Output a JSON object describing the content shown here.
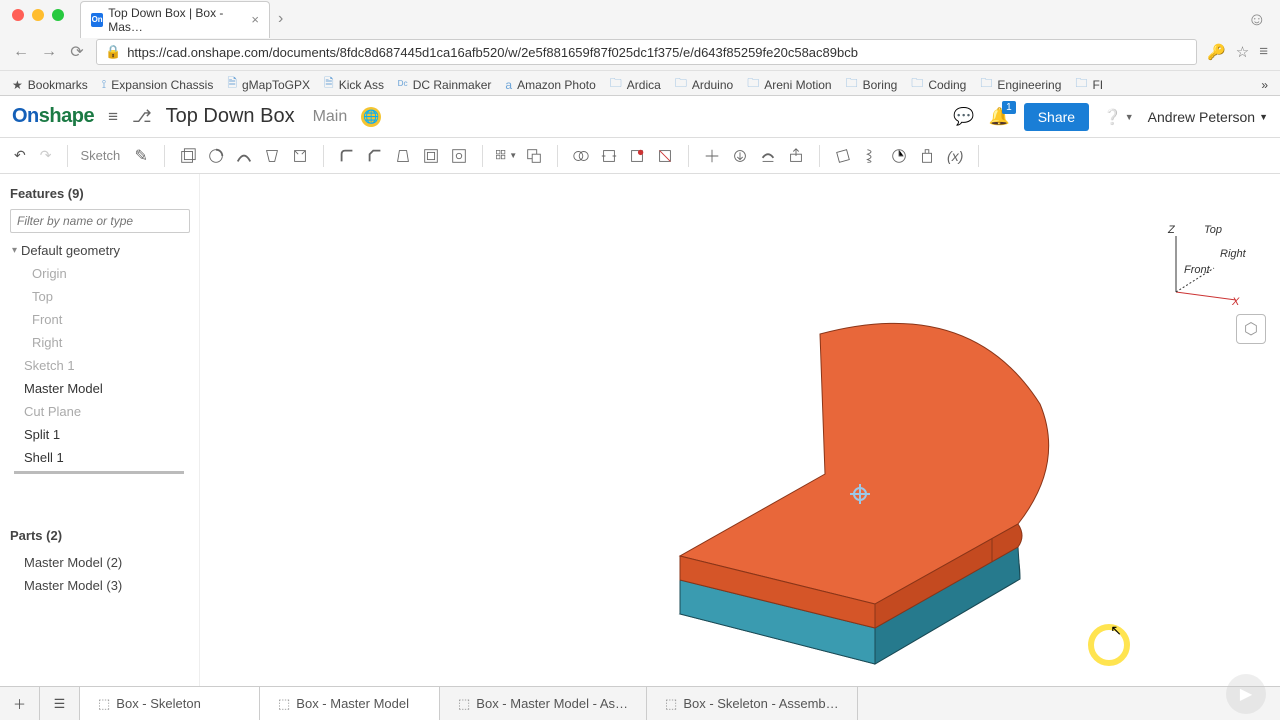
{
  "browser": {
    "tab_title": "Top Down Box | Box - Mas…",
    "favicon": "On",
    "url": "https://cad.onshape.com/documents/8fdc8d687445d1ca16afb520/w/2e5f881659f87f025dc1f375/e/d643f85259fe20c58ac89bcb",
    "bookmarks_label": "Bookmarks",
    "bookmarks": [
      "Expansion Chassis",
      "gMapToGPX",
      "Kick Ass",
      "DC Rainmaker",
      "Amazon Photo",
      "Ardica",
      "Arduino",
      "Areni Motion",
      "Boring",
      "Coding",
      "Engineering",
      "FI"
    ]
  },
  "app": {
    "logo": "Onshape",
    "doc_title": "Top Down Box",
    "branch": "Main",
    "share": "Share",
    "notif_count": "1",
    "user": "Andrew Peterson"
  },
  "toolbar": {
    "sketch": "Sketch"
  },
  "features": {
    "title": "Features (9)",
    "filter_placeholder": "Filter by name or type",
    "group": "Default geometry",
    "items": [
      {
        "label": "Origin",
        "active": false
      },
      {
        "label": "Top",
        "active": false
      },
      {
        "label": "Front",
        "active": false
      },
      {
        "label": "Right",
        "active": false
      },
      {
        "label": "Sketch 1",
        "active": false
      },
      {
        "label": "Master Model",
        "active": true
      },
      {
        "label": "Cut Plane",
        "active": false
      },
      {
        "label": "Split 1",
        "active": true
      },
      {
        "label": "Shell 1",
        "active": true
      }
    ]
  },
  "parts": {
    "title": "Parts (2)",
    "items": [
      "Master Model (2)",
      "Master Model (3)"
    ]
  },
  "viewcube": {
    "z": "Z",
    "x": "X",
    "front": "Front",
    "top": "Top",
    "right": "Right"
  },
  "tabs": {
    "items": [
      {
        "label": "Box - Skeleton",
        "active": true
      },
      {
        "label": "Box - Master Model",
        "active": true
      },
      {
        "label": "Box - Master Model - As…",
        "active": false
      },
      {
        "label": "Box - Skeleton - Assemb…",
        "active": false
      }
    ]
  }
}
